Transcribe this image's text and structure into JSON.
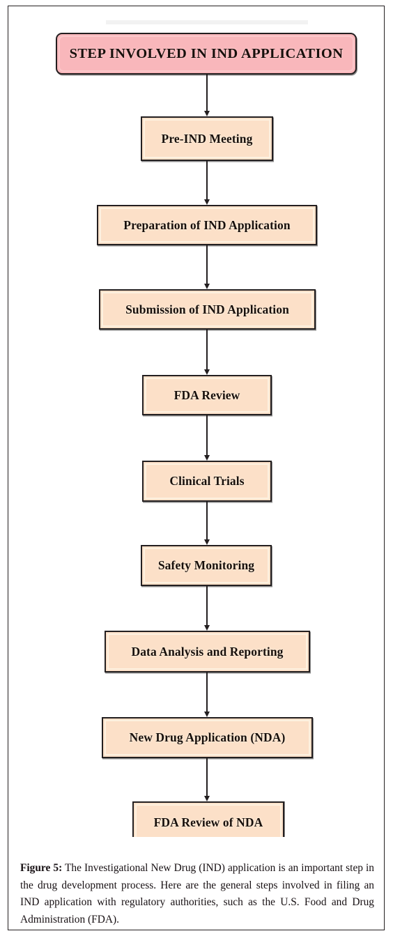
{
  "figure": {
    "title_box": {
      "label": "STEP INVOLVED IN IND APPLICATION",
      "fill": "#F9B7BB",
      "border": "#231F20"
    },
    "node_fill": "#FCE0C8",
    "node_border": "#231F20",
    "connector_color": "#231F20",
    "steps": [
      {
        "label": "Pre-IND Meeting"
      },
      {
        "label": "Preparation of IND Application"
      },
      {
        "label": "Submission of IND Application"
      },
      {
        "label": "FDA Review"
      },
      {
        "label": "Clinical Trials"
      },
      {
        "label": "Safety Monitoring"
      },
      {
        "label": "Data Analysis and Reporting"
      },
      {
        "label": "New Drug Application (NDA)"
      },
      {
        "label": "FDA Review of NDA"
      }
    ]
  },
  "caption": {
    "figure_label": "Figure 5:",
    "text": " The Investigational New Drug (IND) application is an important step in the drug development process. Here are the general steps involved in filing an IND application with regulatory authorities, such as the U.S. Food and Drug Administration (FDA)."
  },
  "chart_data": {
    "type": "diagram",
    "subtype": "flowchart",
    "orientation": "vertical",
    "title": "STEP INVOLVED IN IND APPLICATION",
    "nodes": [
      "STEP INVOLVED IN IND APPLICATION",
      "Pre-IND Meeting",
      "Preparation of IND Application",
      "Submission of IND Application",
      "FDA Review",
      "Clinical Trials",
      "Safety Monitoring",
      "Data Analysis and Reporting",
      "New Drug Application (NDA)",
      "FDA Review of NDA"
    ],
    "edges": [
      [
        "STEP INVOLVED IN IND APPLICATION",
        "Pre-IND Meeting"
      ],
      [
        "Pre-IND Meeting",
        "Preparation of IND Application"
      ],
      [
        "Preparation of IND Application",
        "Submission of IND Application"
      ],
      [
        "Submission of IND Application",
        "FDA Review"
      ],
      [
        "FDA Review",
        "Clinical Trials"
      ],
      [
        "Clinical Trials",
        "Safety Monitoring"
      ],
      [
        "Safety Monitoring",
        "Data Analysis and Reporting"
      ],
      [
        "Data Analysis and Reporting",
        "New Drug Application (NDA)"
      ],
      [
        "New Drug Application (NDA)",
        "FDA Review of NDA"
      ]
    ]
  }
}
